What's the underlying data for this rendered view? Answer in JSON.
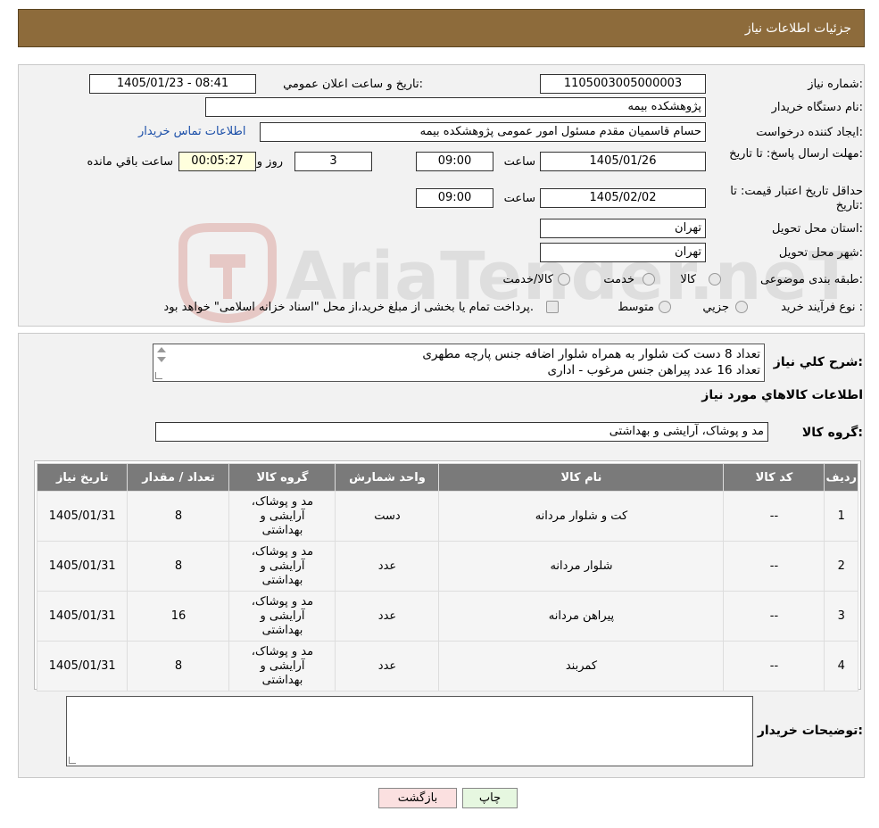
{
  "header": {
    "title": "جزئیات اطلاعات نیاز"
  },
  "labels": {
    "need_number": "شماره نیاز:",
    "announce_datetime": "تاریخ و ساعت اعلان عمومي:",
    "buyer_org": "نام دستگاه خريدار:",
    "requester": "ايجاد کننده درخواست:",
    "reply_deadline": "مهلت ارسال پاسخ: تا تاریخ:",
    "price_validity": "حداقل تاريخ اعتبار قيمت: تا تاریخ:",
    "time": "ساعت",
    "days_and": "روز و",
    "hours_remaining": "ساعت باقي مانده",
    "delivery_province": "استان محل تحويل:",
    "delivery_city": "شهر محل تحويل:",
    "category": "طبقه بندی موضوعی:",
    "purchase_type": "نوع فرآيند خريد :",
    "description": "شرح کلي نياز:",
    "goods_info": "اطلاعات کالاهاي مورد نياز",
    "goods_group": "گروه کالا:",
    "buyer_notes": "توضيحات خريدار:"
  },
  "fields": {
    "need_number": "1105003005000003",
    "announce_datetime": "1405/01/23 - 08:41",
    "buyer_org": "پژوهشکده بیمه",
    "requester": "حسام قاسمیان مقدم مسئول امور عمومی پژوهشکده بیمه",
    "contact_link": "اطلاعات تماس خريدار",
    "reply_date": "1405/01/26",
    "reply_time": "09:00",
    "days": "3",
    "remaining": "00:05:27",
    "validity_date": "1405/02/02",
    "validity_time": "09:00",
    "province": "تهران",
    "city": "تهران",
    "goods_group": "مد و پوشاک، آرایشی و بهداشتی"
  },
  "category_options": [
    "کالا",
    "خدمت",
    "کالا/خدمت"
  ],
  "purchase_options": [
    "جزيي",
    "متوسط"
  ],
  "purchase_note": "پرداخت تمام یا بخشی از مبلغ خرید،از محل \"اسناد خزانه اسلامی\" خواهد بود.",
  "description_lines": [
    "تعداد 8 دست کت شلوار به همراه شلوار اضافه جنس پارچه مطهری",
    "تعداد 16 عدد پیراهن جنس مرغوب - اداری"
  ],
  "table": {
    "headers": [
      "رديف",
      "کد کالا",
      "نام کالا",
      "واحد شمارش",
      "گروه کالا",
      "تعداد / مقدار",
      "تاريخ نياز"
    ],
    "rows": [
      {
        "row": "1",
        "code": "--",
        "name": "کت و شلوار مردانه",
        "unit": "دست",
        "group": [
          "مد و پوشاک،",
          "آرایشی و",
          "بهداشتی"
        ],
        "qty": "8",
        "date": "1405/01/31"
      },
      {
        "row": "2",
        "code": "--",
        "name": "شلوار مردانه",
        "unit": "عدد",
        "group": [
          "مد و پوشاک،",
          "آرایشی و",
          "بهداشتی"
        ],
        "qty": "8",
        "date": "1405/01/31"
      },
      {
        "row": "3",
        "code": "--",
        "name": "پیراهن مردانه",
        "unit": "عدد",
        "group": [
          "مد و پوشاک،",
          "آرایشی و",
          "بهداشتی"
        ],
        "qty": "16",
        "date": "1405/01/31"
      },
      {
        "row": "4",
        "code": "--",
        "name": "کمربند",
        "unit": "عدد",
        "group": [
          "مد و پوشاک،",
          "آرایشی و",
          "بهداشتی"
        ],
        "qty": "8",
        "date": "1405/01/31"
      }
    ]
  },
  "buttons": {
    "print": "چاپ",
    "back": "بازگشت"
  },
  "watermark": {
    "text": "AriaTender.neT"
  },
  "colors": {
    "header": "#8d6b3b",
    "print_bg": "#e6f7e0",
    "back_bg": "#fbe0e0",
    "table_header": "#7a7a7a"
  }
}
